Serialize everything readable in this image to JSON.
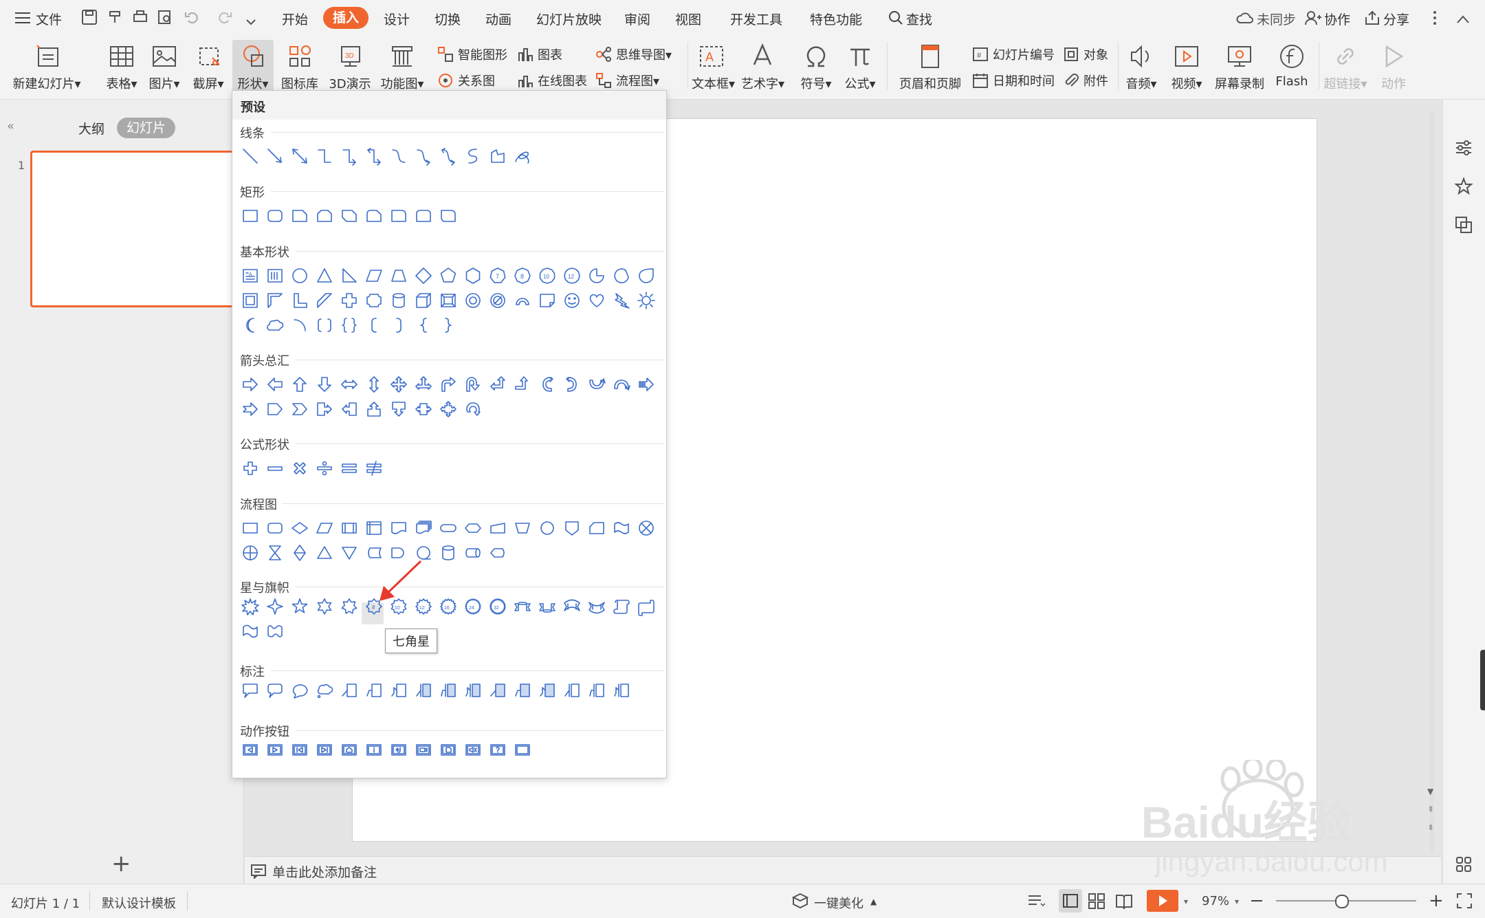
{
  "menubar": {
    "file": "文件",
    "tabs": [
      "开始",
      "插入",
      "设计",
      "切换",
      "动画",
      "幻灯片放映",
      "审阅",
      "视图",
      "开发工具",
      "特色功能"
    ],
    "active_tab": "插入",
    "search": "查找",
    "sync": "未同步",
    "collab": "协作",
    "share": "分享"
  },
  "ribbon": {
    "new_slide": "新建幻灯片",
    "table": "表格",
    "picture": "图片",
    "screenshot": "截屏",
    "shape": "形状",
    "icon_lib": "图标库",
    "demo3d": "3D演示",
    "func_chart": "功能图",
    "smart_art": "智能图形",
    "chart": "图表",
    "relation": "关系图",
    "online_chart": "在线图表",
    "mindmap": "思维导图",
    "flowchart": "流程图",
    "textbox": "文本框",
    "wordart": "艺术字",
    "symbol": "符号",
    "formula": "公式",
    "header_footer": "页眉和页脚",
    "slide_number": "幻灯片编号",
    "object": "对象",
    "datetime": "日期和时间",
    "attachment": "附件",
    "audio": "音频",
    "video": "视频",
    "screen_record": "屏幕录制",
    "flash": "Flash",
    "hyperlink": "超链接",
    "action": "动作"
  },
  "leftpane": {
    "outline_tab": "大纲",
    "slides_tab": "幻灯片",
    "slide_number": "1"
  },
  "notes": {
    "placeholder": "单击此处添加备注"
  },
  "status": {
    "slide_count": "幻灯片 1 / 1",
    "template": "默认设计模板",
    "beautify": "一键美化",
    "zoom": "97%"
  },
  "shapes_menu": {
    "header": "预设",
    "sections": {
      "lines": "线条",
      "rect": "矩形",
      "basic": "基本形状",
      "arrows": "箭头总汇",
      "equation": "公式形状",
      "flowchart": "流程图",
      "stars": "星与旗帜",
      "callouts": "标注",
      "actions": "动作按钮"
    },
    "star_labels": [
      "8",
      "10",
      "12",
      "16",
      "24",
      "32"
    ],
    "tooltip": "七角星"
  },
  "watermark": {
    "brand": "Baidu经验",
    "url": "jingyan.baidu.com"
  },
  "colors": {
    "accent": "#f0652e",
    "shape_stroke": "#3e6fc9",
    "arrow": "#e53b2c"
  }
}
